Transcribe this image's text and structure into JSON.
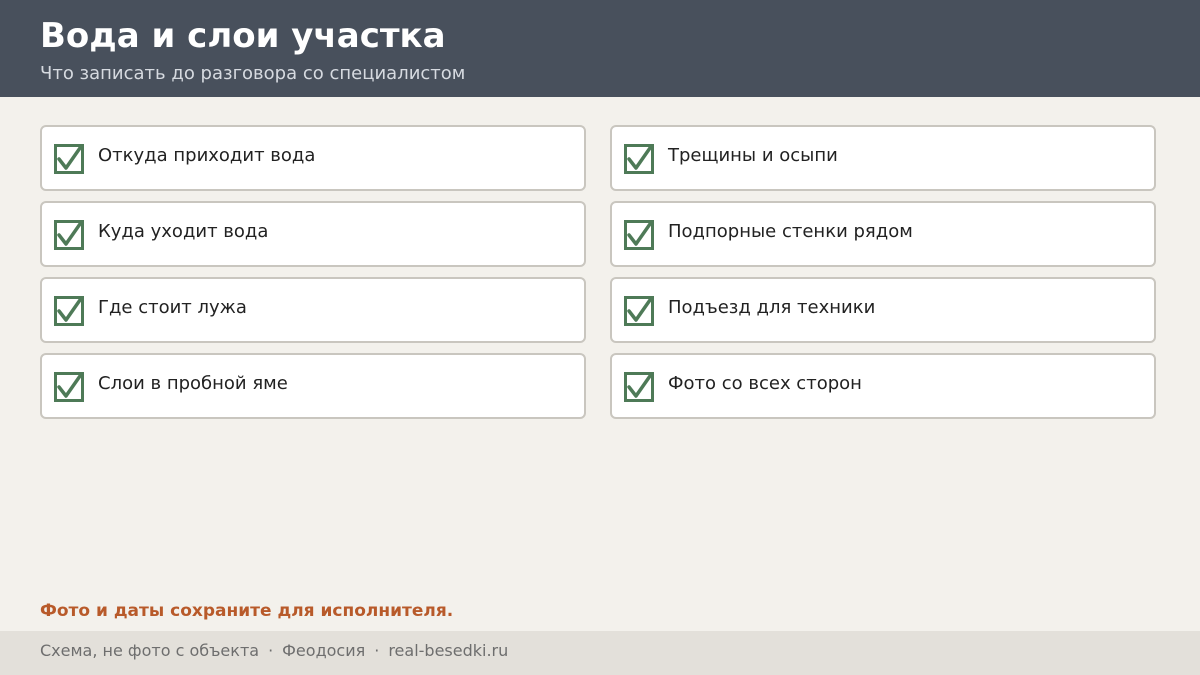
{
  "header": {
    "title": "Вода и слои участка",
    "subtitle": "Что записать до разговора со специалистом"
  },
  "checklist": {
    "items": [
      {
        "label": "Откуда приходит вода",
        "checked": true
      },
      {
        "label": "Трещины и осыпи",
        "checked": true
      },
      {
        "label": "Куда уходит вода",
        "checked": true
      },
      {
        "label": "Подпорные стенки рядом",
        "checked": true
      },
      {
        "label": "Где стоит лужа",
        "checked": true
      },
      {
        "label": "Подъезд для техники",
        "checked": true
      },
      {
        "label": "Слои в пробной яме",
        "checked": true
      },
      {
        "label": "Фото со всех сторон",
        "checked": true
      }
    ],
    "check_icon": "checked-box-icon",
    "check_color": "#4e7a57"
  },
  "note": "Фото и даты сохраните для исполнителя.",
  "footer": {
    "parts": [
      "Схема, не фото с объекта",
      "Феодосия",
      "real-besedki.ru"
    ],
    "separator": "·"
  },
  "colors": {
    "header_bg": "#48505c",
    "page_bg": "#f3f1ec",
    "accent": "#b85a2a",
    "footer_bg": "#e3e0da"
  }
}
